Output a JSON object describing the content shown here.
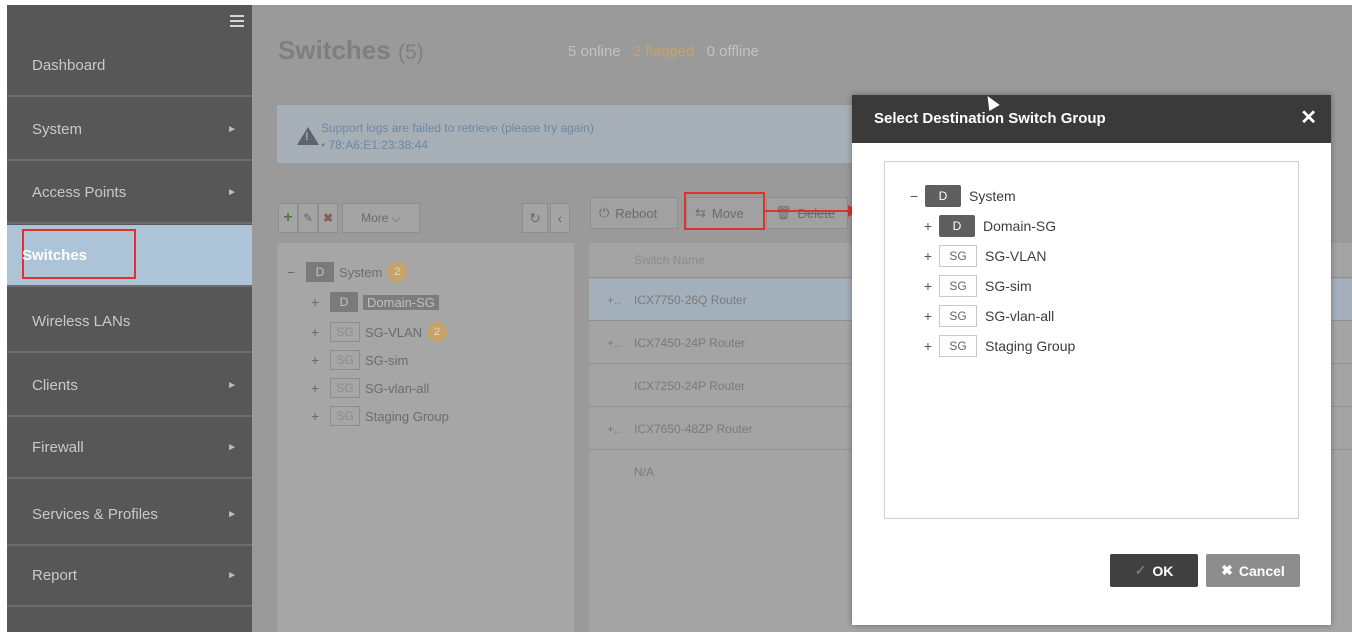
{
  "sidebar": {
    "items": [
      {
        "label": "Dashboard",
        "arrow": ""
      },
      {
        "label": "System",
        "arrow": "►"
      },
      {
        "label": "Access Points",
        "arrow": "►"
      },
      {
        "label": "Switches",
        "arrow": ""
      },
      {
        "label": "Wireless LANs",
        "arrow": ""
      },
      {
        "label": "Clients",
        "arrow": "►"
      },
      {
        "label": "Firewall",
        "arrow": "►"
      },
      {
        "label": "Services & Profiles",
        "arrow": "►"
      },
      {
        "label": "Report",
        "arrow": "►"
      }
    ]
  },
  "header": {
    "title": "Switches",
    "count": "(5)",
    "online": "5 online",
    "flagged": "2 flagged",
    "offline": "0 offline"
  },
  "alert": {
    "message": "Support logs are failed to retrieve (please try again)",
    "mac": "•  78:A6:E1:23:38:44"
  },
  "tree_toolbar": {
    "more": "More ⌵"
  },
  "left_tree": {
    "root_label": "System",
    "root_badge": "D",
    "root_count": "2",
    "domain_badge": "D",
    "domain_label": "Domain-SG",
    "sg_badge": "SG",
    "vlan": "SG-VLAN",
    "vlan_count": "2",
    "sim": "SG-sim",
    "vlan_all": "SG-vlan-all",
    "staging": "Staging Group"
  },
  "switch_toolbar": {
    "reboot": "Reboot",
    "move": "Move",
    "delete": "Delete"
  },
  "table": {
    "header": "Switch Name",
    "rows": [
      "ICX7750-26Q Router",
      "ICX7450-24P Router",
      "ICX7250-24P Router",
      "ICX7650-48ZP Router",
      "N/A"
    ]
  },
  "modal": {
    "title": "Select Destination Switch Group",
    "root_badge": "D",
    "root_label": "System",
    "domain_badge": "D",
    "domain_label": "Domain-SG",
    "sg_badge": "SG",
    "sg_vlan": "SG-VLAN",
    "sg_sim": "SG-sim",
    "sg_vlan_all": "SG-vlan-all",
    "staging": "Staging Group",
    "ok": "OK",
    "cancel": "Cancel"
  },
  "colors": {
    "sidebar": "#575757",
    "active_nav": "#adc3d7",
    "modal_header": "#3a3a3a",
    "highlight": "#e03030",
    "flagged": "#c6a36b"
  }
}
